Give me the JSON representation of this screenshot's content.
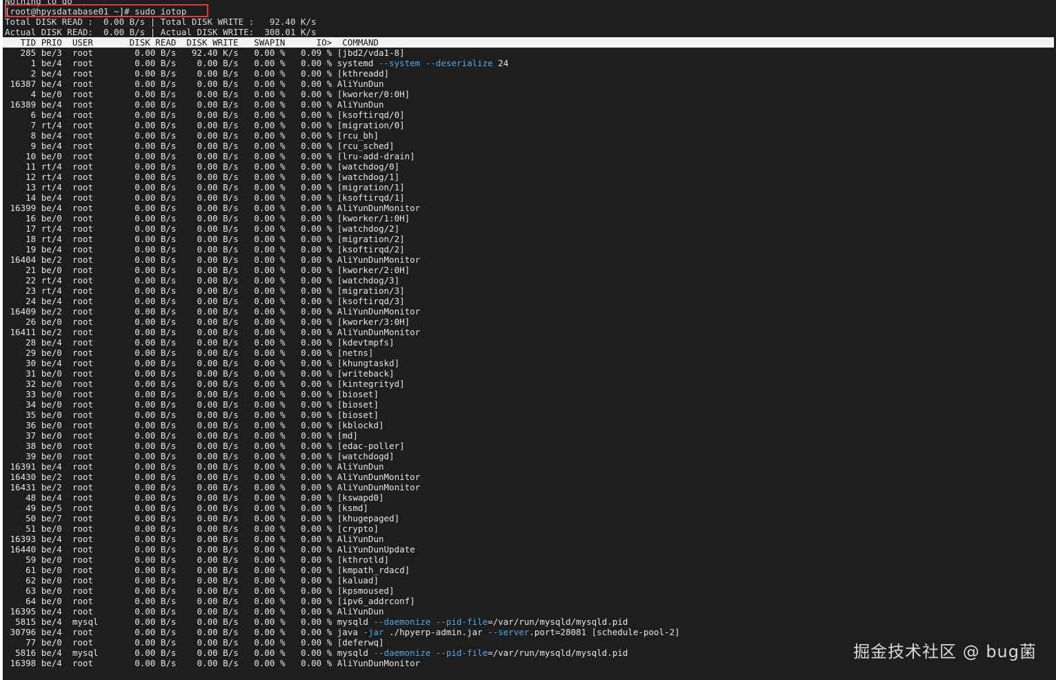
{
  "header": {
    "prev_line": "Nothing to do",
    "prompt": "[root@hpysdatabase01 ~]# sudo iotop",
    "total_read_label": "Total DISK READ :",
    "total_read": "0.00 B/s",
    "total_write_label": "Total DISK WRITE :",
    "total_write": "92.40 K/s",
    "actual_read_label": "Actual DISK READ:",
    "actual_read": "0.00 B/s",
    "actual_write_label": "Actual DISK WRITE:",
    "actual_write": "308.01 K/s"
  },
  "columns": [
    "TID",
    "PRIO",
    "USER",
    "DISK READ",
    "DISK WRITE",
    "SWAPIN",
    "IO>",
    "COMMAND"
  ],
  "rows": [
    {
      "tid": "285",
      "prio": "be/3",
      "user": "root",
      "read": "0.00 B/s",
      "write": "92.40 K/s",
      "swapin": "0.00 %",
      "io": "0.09 %",
      "cmd": "[jbd2/vda1-8]"
    },
    {
      "tid": "1",
      "prio": "be/4",
      "user": "root",
      "read": "0.00 B/s",
      "write": "0.00 B/s",
      "swapin": "0.00 %",
      "io": "0.00 %",
      "cmd": "systemd --system --deserialize 24"
    },
    {
      "tid": "2",
      "prio": "be/4",
      "user": "root",
      "read": "0.00 B/s",
      "write": "0.00 B/s",
      "swapin": "0.00 %",
      "io": "0.00 %",
      "cmd": "[kthreadd]"
    },
    {
      "tid": "16387",
      "prio": "be/4",
      "user": "root",
      "read": "0.00 B/s",
      "write": "0.00 B/s",
      "swapin": "0.00 %",
      "io": "0.00 %",
      "cmd": "AliYunDun"
    },
    {
      "tid": "4",
      "prio": "be/0",
      "user": "root",
      "read": "0.00 B/s",
      "write": "0.00 B/s",
      "swapin": "0.00 %",
      "io": "0.00 %",
      "cmd": "[kworker/0:0H]"
    },
    {
      "tid": "16389",
      "prio": "be/4",
      "user": "root",
      "read": "0.00 B/s",
      "write": "0.00 B/s",
      "swapin": "0.00 %",
      "io": "0.00 %",
      "cmd": "AliYunDun"
    },
    {
      "tid": "6",
      "prio": "be/4",
      "user": "root",
      "read": "0.00 B/s",
      "write": "0.00 B/s",
      "swapin": "0.00 %",
      "io": "0.00 %",
      "cmd": "[ksoftirqd/0]"
    },
    {
      "tid": "7",
      "prio": "rt/4",
      "user": "root",
      "read": "0.00 B/s",
      "write": "0.00 B/s",
      "swapin": "0.00 %",
      "io": "0.00 %",
      "cmd": "[migration/0]"
    },
    {
      "tid": "8",
      "prio": "be/4",
      "user": "root",
      "read": "0.00 B/s",
      "write": "0.00 B/s",
      "swapin": "0.00 %",
      "io": "0.00 %",
      "cmd": "[rcu_bh]"
    },
    {
      "tid": "9",
      "prio": "be/4",
      "user": "root",
      "read": "0.00 B/s",
      "write": "0.00 B/s",
      "swapin": "0.00 %",
      "io": "0.00 %",
      "cmd": "[rcu_sched]"
    },
    {
      "tid": "10",
      "prio": "be/0",
      "user": "root",
      "read": "0.00 B/s",
      "write": "0.00 B/s",
      "swapin": "0.00 %",
      "io": "0.00 %",
      "cmd": "[lru-add-drain]"
    },
    {
      "tid": "11",
      "prio": "rt/4",
      "user": "root",
      "read": "0.00 B/s",
      "write": "0.00 B/s",
      "swapin": "0.00 %",
      "io": "0.00 %",
      "cmd": "[watchdog/0]"
    },
    {
      "tid": "12",
      "prio": "rt/4",
      "user": "root",
      "read": "0.00 B/s",
      "write": "0.00 B/s",
      "swapin": "0.00 %",
      "io": "0.00 %",
      "cmd": "[watchdog/1]"
    },
    {
      "tid": "13",
      "prio": "rt/4",
      "user": "root",
      "read": "0.00 B/s",
      "write": "0.00 B/s",
      "swapin": "0.00 %",
      "io": "0.00 %",
      "cmd": "[migration/1]"
    },
    {
      "tid": "14",
      "prio": "be/4",
      "user": "root",
      "read": "0.00 B/s",
      "write": "0.00 B/s",
      "swapin": "0.00 %",
      "io": "0.00 %",
      "cmd": "[ksoftirqd/1]"
    },
    {
      "tid": "16399",
      "prio": "be/4",
      "user": "root",
      "read": "0.00 B/s",
      "write": "0.00 B/s",
      "swapin": "0.00 %",
      "io": "0.00 %",
      "cmd": "AliYunDunMonitor"
    },
    {
      "tid": "16",
      "prio": "be/0",
      "user": "root",
      "read": "0.00 B/s",
      "write": "0.00 B/s",
      "swapin": "0.00 %",
      "io": "0.00 %",
      "cmd": "[kworker/1:0H]"
    },
    {
      "tid": "17",
      "prio": "rt/4",
      "user": "root",
      "read": "0.00 B/s",
      "write": "0.00 B/s",
      "swapin": "0.00 %",
      "io": "0.00 %",
      "cmd": "[watchdog/2]"
    },
    {
      "tid": "18",
      "prio": "rt/4",
      "user": "root",
      "read": "0.00 B/s",
      "write": "0.00 B/s",
      "swapin": "0.00 %",
      "io": "0.00 %",
      "cmd": "[migration/2]"
    },
    {
      "tid": "19",
      "prio": "be/4",
      "user": "root",
      "read": "0.00 B/s",
      "write": "0.00 B/s",
      "swapin": "0.00 %",
      "io": "0.00 %",
      "cmd": "[ksoftirqd/2]"
    },
    {
      "tid": "16404",
      "prio": "be/2",
      "user": "root",
      "read": "0.00 B/s",
      "write": "0.00 B/s",
      "swapin": "0.00 %",
      "io": "0.00 %",
      "cmd": "AliYunDunMonitor"
    },
    {
      "tid": "21",
      "prio": "be/0",
      "user": "root",
      "read": "0.00 B/s",
      "write": "0.00 B/s",
      "swapin": "0.00 %",
      "io": "0.00 %",
      "cmd": "[kworker/2:0H]"
    },
    {
      "tid": "22",
      "prio": "rt/4",
      "user": "root",
      "read": "0.00 B/s",
      "write": "0.00 B/s",
      "swapin": "0.00 %",
      "io": "0.00 %",
      "cmd": "[watchdog/3]"
    },
    {
      "tid": "23",
      "prio": "rt/4",
      "user": "root",
      "read": "0.00 B/s",
      "write": "0.00 B/s",
      "swapin": "0.00 %",
      "io": "0.00 %",
      "cmd": "[migration/3]"
    },
    {
      "tid": "24",
      "prio": "be/4",
      "user": "root",
      "read": "0.00 B/s",
      "write": "0.00 B/s",
      "swapin": "0.00 %",
      "io": "0.00 %",
      "cmd": "[ksoftirqd/3]"
    },
    {
      "tid": "16409",
      "prio": "be/2",
      "user": "root",
      "read": "0.00 B/s",
      "write": "0.00 B/s",
      "swapin": "0.00 %",
      "io": "0.00 %",
      "cmd": "AliYunDunMonitor"
    },
    {
      "tid": "26",
      "prio": "be/0",
      "user": "root",
      "read": "0.00 B/s",
      "write": "0.00 B/s",
      "swapin": "0.00 %",
      "io": "0.00 %",
      "cmd": "[kworker/3:0H]"
    },
    {
      "tid": "16411",
      "prio": "be/2",
      "user": "root",
      "read": "0.00 B/s",
      "write": "0.00 B/s",
      "swapin": "0.00 %",
      "io": "0.00 %",
      "cmd": "AliYunDunMonitor"
    },
    {
      "tid": "28",
      "prio": "be/4",
      "user": "root",
      "read": "0.00 B/s",
      "write": "0.00 B/s",
      "swapin": "0.00 %",
      "io": "0.00 %",
      "cmd": "[kdevtmpfs]"
    },
    {
      "tid": "29",
      "prio": "be/0",
      "user": "root",
      "read": "0.00 B/s",
      "write": "0.00 B/s",
      "swapin": "0.00 %",
      "io": "0.00 %",
      "cmd": "[netns]"
    },
    {
      "tid": "30",
      "prio": "be/4",
      "user": "root",
      "read": "0.00 B/s",
      "write": "0.00 B/s",
      "swapin": "0.00 %",
      "io": "0.00 %",
      "cmd": "[khungtaskd]"
    },
    {
      "tid": "31",
      "prio": "be/0",
      "user": "root",
      "read": "0.00 B/s",
      "write": "0.00 B/s",
      "swapin": "0.00 %",
      "io": "0.00 %",
      "cmd": "[writeback]"
    },
    {
      "tid": "32",
      "prio": "be/0",
      "user": "root",
      "read": "0.00 B/s",
      "write": "0.00 B/s",
      "swapin": "0.00 %",
      "io": "0.00 %",
      "cmd": "[kintegrityd]"
    },
    {
      "tid": "33",
      "prio": "be/0",
      "user": "root",
      "read": "0.00 B/s",
      "write": "0.00 B/s",
      "swapin": "0.00 %",
      "io": "0.00 %",
      "cmd": "[bioset]"
    },
    {
      "tid": "34",
      "prio": "be/0",
      "user": "root",
      "read": "0.00 B/s",
      "write": "0.00 B/s",
      "swapin": "0.00 %",
      "io": "0.00 %",
      "cmd": "[bioset]"
    },
    {
      "tid": "35",
      "prio": "be/0",
      "user": "root",
      "read": "0.00 B/s",
      "write": "0.00 B/s",
      "swapin": "0.00 %",
      "io": "0.00 %",
      "cmd": "[bioset]"
    },
    {
      "tid": "36",
      "prio": "be/0",
      "user": "root",
      "read": "0.00 B/s",
      "write": "0.00 B/s",
      "swapin": "0.00 %",
      "io": "0.00 %",
      "cmd": "[kblockd]"
    },
    {
      "tid": "37",
      "prio": "be/0",
      "user": "root",
      "read": "0.00 B/s",
      "write": "0.00 B/s",
      "swapin": "0.00 %",
      "io": "0.00 %",
      "cmd": "[md]"
    },
    {
      "tid": "38",
      "prio": "be/0",
      "user": "root",
      "read": "0.00 B/s",
      "write": "0.00 B/s",
      "swapin": "0.00 %",
      "io": "0.00 %",
      "cmd": "[edac-poller]"
    },
    {
      "tid": "39",
      "prio": "be/0",
      "user": "root",
      "read": "0.00 B/s",
      "write": "0.00 B/s",
      "swapin": "0.00 %",
      "io": "0.00 %",
      "cmd": "[watchdogd]"
    },
    {
      "tid": "16391",
      "prio": "be/4",
      "user": "root",
      "read": "0.00 B/s",
      "write": "0.00 B/s",
      "swapin": "0.00 %",
      "io": "0.00 %",
      "cmd": "AliYunDun"
    },
    {
      "tid": "16430",
      "prio": "be/2",
      "user": "root",
      "read": "0.00 B/s",
      "write": "0.00 B/s",
      "swapin": "0.00 %",
      "io": "0.00 %",
      "cmd": "AliYunDunMonitor"
    },
    {
      "tid": "16431",
      "prio": "be/2",
      "user": "root",
      "read": "0.00 B/s",
      "write": "0.00 B/s",
      "swapin": "0.00 %",
      "io": "0.00 %",
      "cmd": "AliYunDunMonitor"
    },
    {
      "tid": "48",
      "prio": "be/4",
      "user": "root",
      "read": "0.00 B/s",
      "write": "0.00 B/s",
      "swapin": "0.00 %",
      "io": "0.00 %",
      "cmd": "[kswapd0]"
    },
    {
      "tid": "49",
      "prio": "be/5",
      "user": "root",
      "read": "0.00 B/s",
      "write": "0.00 B/s",
      "swapin": "0.00 %",
      "io": "0.00 %",
      "cmd": "[ksmd]"
    },
    {
      "tid": "50",
      "prio": "be/7",
      "user": "root",
      "read": "0.00 B/s",
      "write": "0.00 B/s",
      "swapin": "0.00 %",
      "io": "0.00 %",
      "cmd": "[khugepaged]"
    },
    {
      "tid": "51",
      "prio": "be/0",
      "user": "root",
      "read": "0.00 B/s",
      "write": "0.00 B/s",
      "swapin": "0.00 %",
      "io": "0.00 %",
      "cmd": "[crypto]"
    },
    {
      "tid": "16393",
      "prio": "be/4",
      "user": "root",
      "read": "0.00 B/s",
      "write": "0.00 B/s",
      "swapin": "0.00 %",
      "io": "0.00 %",
      "cmd": "AliYunDun"
    },
    {
      "tid": "16440",
      "prio": "be/4",
      "user": "root",
      "read": "0.00 B/s",
      "write": "0.00 B/s",
      "swapin": "0.00 %",
      "io": "0.00 %",
      "cmd": "AliYunDunUpdate"
    },
    {
      "tid": "59",
      "prio": "be/0",
      "user": "root",
      "read": "0.00 B/s",
      "write": "0.00 B/s",
      "swapin": "0.00 %",
      "io": "0.00 %",
      "cmd": "[kthrotld]"
    },
    {
      "tid": "61",
      "prio": "be/0",
      "user": "root",
      "read": "0.00 B/s",
      "write": "0.00 B/s",
      "swapin": "0.00 %",
      "io": "0.00 %",
      "cmd": "[kmpath_rdacd]"
    },
    {
      "tid": "62",
      "prio": "be/0",
      "user": "root",
      "read": "0.00 B/s",
      "write": "0.00 B/s",
      "swapin": "0.00 %",
      "io": "0.00 %",
      "cmd": "[kaluad]"
    },
    {
      "tid": "63",
      "prio": "be/0",
      "user": "root",
      "read": "0.00 B/s",
      "write": "0.00 B/s",
      "swapin": "0.00 %",
      "io": "0.00 %",
      "cmd": "[kpsmoused]"
    },
    {
      "tid": "64",
      "prio": "be/0",
      "user": "root",
      "read": "0.00 B/s",
      "write": "0.00 B/s",
      "swapin": "0.00 %",
      "io": "0.00 %",
      "cmd": "[ipv6_addrconf]"
    },
    {
      "tid": "16395",
      "prio": "be/4",
      "user": "root",
      "read": "0.00 B/s",
      "write": "0.00 B/s",
      "swapin": "0.00 %",
      "io": "0.00 %",
      "cmd": "AliYunDun"
    },
    {
      "tid": "5815",
      "prio": "be/4",
      "user": "mysql",
      "read": "0.00 B/s",
      "write": "0.00 B/s",
      "swapin": "0.00 %",
      "io": "0.00 %",
      "cmd": "mysqld --daemonize --pid-file=/var/run/mysqld/mysqld.pid"
    },
    {
      "tid": "30796",
      "prio": "be/4",
      "user": "root",
      "read": "0.00 B/s",
      "write": "0.00 B/s",
      "swapin": "0.00 %",
      "io": "0.00 %",
      "cmd": "java -jar ./hpyerp-admin.jar --server.port=28081 [schedule-pool-2]"
    },
    {
      "tid": "77",
      "prio": "be/0",
      "user": "root",
      "read": "0.00 B/s",
      "write": "0.00 B/s",
      "swapin": "0.00 %",
      "io": "0.00 %",
      "cmd": "[deferwq]"
    },
    {
      "tid": "5816",
      "prio": "be/4",
      "user": "mysql",
      "read": "0.00 B/s",
      "write": "0.00 B/s",
      "swapin": "0.00 %",
      "io": "0.00 %",
      "cmd": "mysqld --daemonize --pid-file=/var/run/mysqld/mysqld.pid"
    },
    {
      "tid": "16398",
      "prio": "be/4",
      "user": "root",
      "read": "0.00 B/s",
      "write": "0.00 B/s",
      "swapin": "0.00 %",
      "io": "0.00 %",
      "cmd": "AliYunDunMonitor"
    }
  ],
  "watermark": "掘金技术社区 @ bug菌",
  "colors": {
    "background": "#1e1e1e",
    "foreground": "#e6e6e6",
    "flag": "#4fa8e8",
    "header_bar": "#f2f2f2",
    "highlight_box": "#e23b3b"
  }
}
